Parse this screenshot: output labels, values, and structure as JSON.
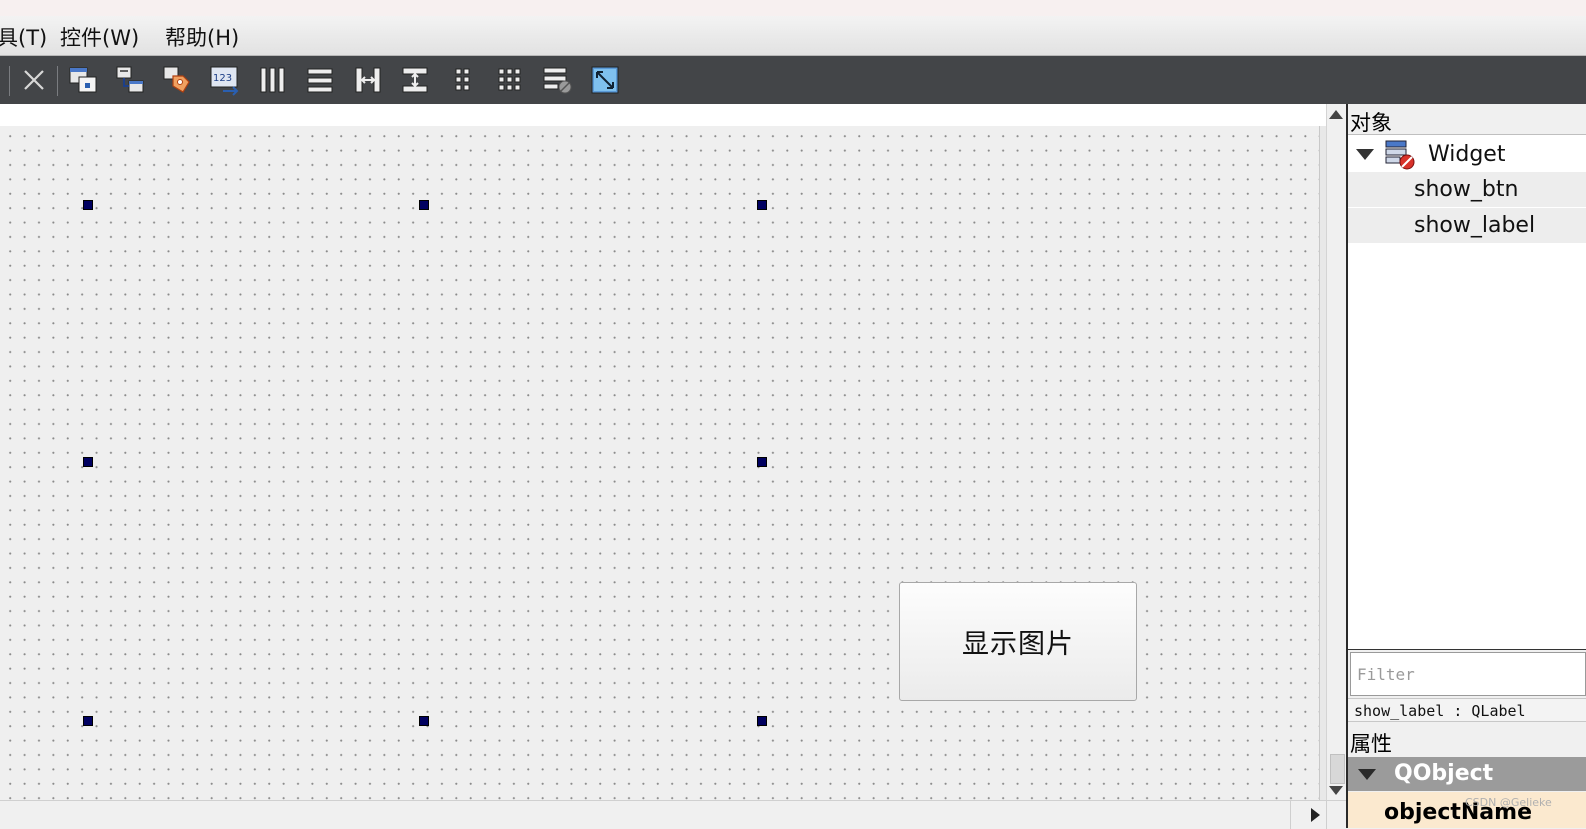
{
  "menu": [
    {
      "label": "具(T)"
    },
    {
      "label": "控件(W)"
    },
    {
      "label": "帮助(H)"
    }
  ],
  "toolbar": {
    "icons": [
      "close-icon",
      "edit-widgets-icon",
      "edit-signals-slots-icon",
      "edit-buddies-icon",
      "edit-tab-order-icon",
      "layout-horizontal-icon",
      "layout-vertical-icon",
      "layout-h-splitter-icon",
      "layout-v-splitter-icon",
      "layout-form-icon",
      "layout-grid-icon",
      "break-layout-icon",
      "adjust-size-icon"
    ]
  },
  "form": {
    "button_text": "显示图片"
  },
  "object_inspector": {
    "title": "对象",
    "root": "Widget",
    "children": [
      "show_btn",
      "show_label"
    ]
  },
  "property_editor": {
    "filter_placeholder": "Filter",
    "selected_object": "show_label : QLabel",
    "title": "属性",
    "group": "QObject",
    "first_property": "objectName"
  },
  "watermark": "CSDN @Gelieke"
}
